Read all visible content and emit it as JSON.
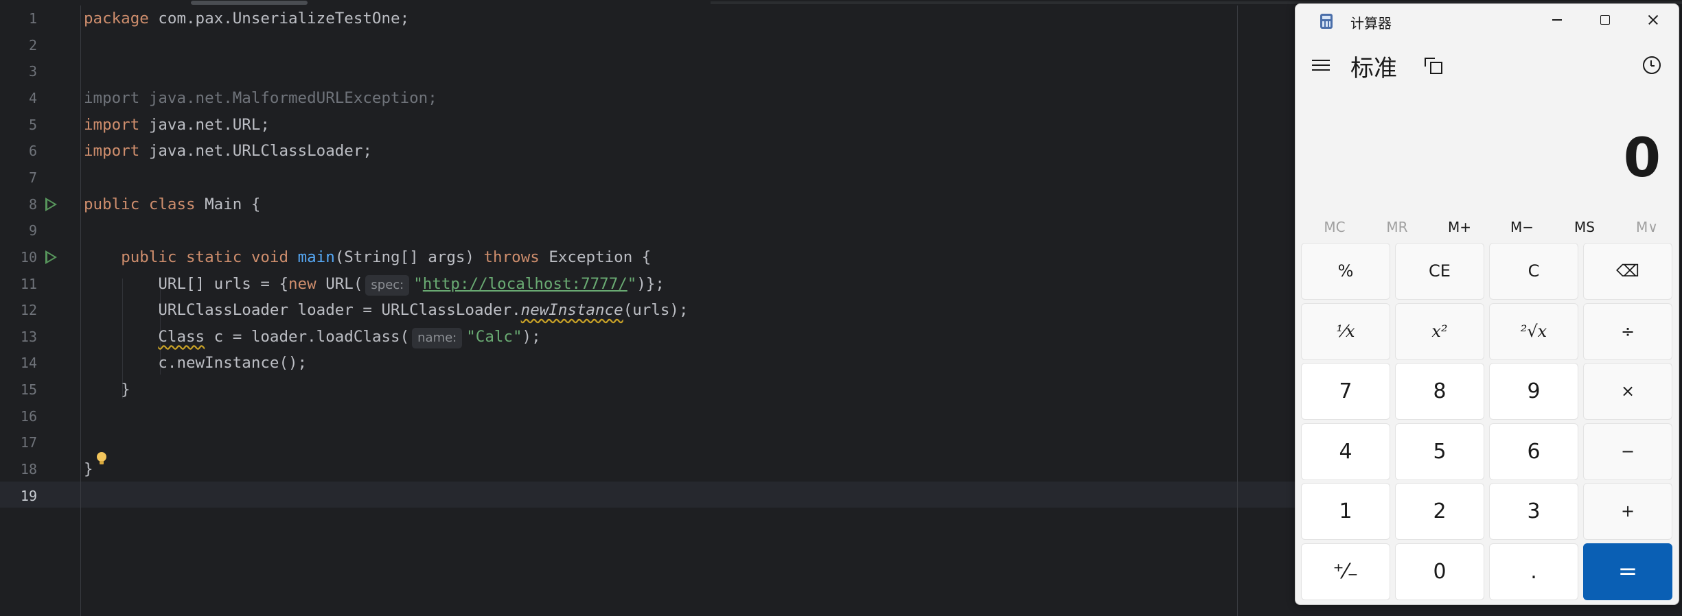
{
  "editor": {
    "lines": [
      {
        "num": "1",
        "tokens": [
          {
            "c": "kw",
            "t": "package"
          },
          {
            "c": "",
            "t": " com.pax.UnserializeTestOne;"
          }
        ]
      },
      {
        "num": "2",
        "tokens": []
      },
      {
        "num": "3",
        "tokens": []
      },
      {
        "num": "4",
        "tokens": [
          {
            "c": "gray",
            "t": "import java.net.MalformedURLException;"
          }
        ]
      },
      {
        "num": "5",
        "tokens": [
          {
            "c": "kw",
            "t": "import"
          },
          {
            "c": "",
            "t": " java.net.URL;"
          }
        ]
      },
      {
        "num": "6",
        "tokens": [
          {
            "c": "kw",
            "t": "import"
          },
          {
            "c": "",
            "t": " java.net.URLClassLoader;"
          }
        ]
      },
      {
        "num": "7",
        "tokens": []
      },
      {
        "num": "8",
        "run": true,
        "tokens": [
          {
            "c": "kw",
            "t": "public class"
          },
          {
            "c": "",
            "t": " Main {"
          }
        ]
      },
      {
        "num": "9",
        "tokens": []
      },
      {
        "num": "10",
        "run": true,
        "tokens": [
          {
            "c": "",
            "t": "    "
          },
          {
            "c": "kw",
            "t": "public static void"
          },
          {
            "c": "",
            "t": " "
          },
          {
            "c": "fn",
            "t": "main"
          },
          {
            "c": "",
            "t": "(String[] args) "
          },
          {
            "c": "kw",
            "t": "throws"
          },
          {
            "c": "",
            "t": " Exception {"
          }
        ]
      },
      {
        "num": "11",
        "tokens": [
          {
            "c": "",
            "t": "        URL[] urls = {"
          },
          {
            "c": "kw",
            "t": "new"
          },
          {
            "c": "",
            "t": " URL("
          },
          {
            "c": "hint",
            "t": "spec:"
          },
          {
            "c": "str",
            "t": "\""
          },
          {
            "c": "url",
            "t": "http://localhost:7777/"
          },
          {
            "c": "str",
            "t": "\""
          },
          {
            "c": "",
            "t": ")};"
          }
        ]
      },
      {
        "num": "12",
        "tokens": [
          {
            "c": "",
            "t": "        URLClassLoader loader = URLClassLoader."
          },
          {
            "c": "italic warn",
            "t": "newInstance"
          },
          {
            "c": "",
            "t": "(urls);"
          }
        ]
      },
      {
        "num": "13",
        "tokens": [
          {
            "c": "",
            "t": "        "
          },
          {
            "c": "warn",
            "t": "Class"
          },
          {
            "c": "",
            "t": " c = loader.loadClass("
          },
          {
            "c": "hint",
            "t": "name:"
          },
          {
            "c": "str",
            "t": "\"Calc\""
          },
          {
            "c": "",
            "t": ");"
          }
        ]
      },
      {
        "num": "14",
        "tokens": [
          {
            "c": "",
            "t": "        c.newInstance();"
          }
        ]
      },
      {
        "num": "15",
        "tokens": [
          {
            "c": "",
            "t": "    }"
          }
        ]
      },
      {
        "num": "16",
        "tokens": []
      },
      {
        "num": "17",
        "tokens": []
      },
      {
        "num": "18",
        "bulb": true,
        "tokens": [
          {
            "c": "",
            "t": "}"
          }
        ]
      },
      {
        "num": "19",
        "active": true,
        "tokens": []
      }
    ]
  },
  "calculator": {
    "window_title": "计算器",
    "mode_title": "标准",
    "display_value": "0",
    "memory_buttons": [
      {
        "label": "MC",
        "disabled": true
      },
      {
        "label": "MR",
        "disabled": true
      },
      {
        "label": "M+",
        "disabled": false
      },
      {
        "label": "M−",
        "disabled": false
      },
      {
        "label": "MS",
        "disabled": false
      },
      {
        "label": "M∨",
        "disabled": true
      }
    ],
    "keys": [
      {
        "label": "%",
        "type": "fnk",
        "name": "percent"
      },
      {
        "label": "CE",
        "type": "fnk",
        "name": "clear-entry"
      },
      {
        "label": "C",
        "type": "fnk",
        "name": "clear"
      },
      {
        "label": "⌫",
        "type": "fnk",
        "name": "backspace"
      },
      {
        "label": "¹⁄x",
        "type": "fnk math",
        "name": "reciprocal"
      },
      {
        "label": "x²",
        "type": "fnk math",
        "name": "square"
      },
      {
        "label": "²√x",
        "type": "fnk math",
        "name": "square-root"
      },
      {
        "label": "÷",
        "type": "fnk",
        "name": "divide"
      },
      {
        "label": "7",
        "type": "num",
        "name": "digit-7"
      },
      {
        "label": "8",
        "type": "num",
        "name": "digit-8"
      },
      {
        "label": "9",
        "type": "num",
        "name": "digit-9"
      },
      {
        "label": "×",
        "type": "fnk",
        "name": "multiply"
      },
      {
        "label": "4",
        "type": "num",
        "name": "digit-4"
      },
      {
        "label": "5",
        "type": "num",
        "name": "digit-5"
      },
      {
        "label": "6",
        "type": "num",
        "name": "digit-6"
      },
      {
        "label": "−",
        "type": "fnk",
        "name": "subtract"
      },
      {
        "label": "1",
        "type": "num",
        "name": "digit-1"
      },
      {
        "label": "2",
        "type": "num",
        "name": "digit-2"
      },
      {
        "label": "3",
        "type": "num",
        "name": "digit-3"
      },
      {
        "label": "+",
        "type": "fnk",
        "name": "add"
      },
      {
        "label": "⁺⁄₋",
        "type": "num",
        "name": "negate"
      },
      {
        "label": "0",
        "type": "num",
        "name": "digit-0"
      },
      {
        "label": ".",
        "type": "num",
        "name": "decimal"
      },
      {
        "label": "=",
        "type": "equals",
        "name": "equals"
      }
    ]
  }
}
